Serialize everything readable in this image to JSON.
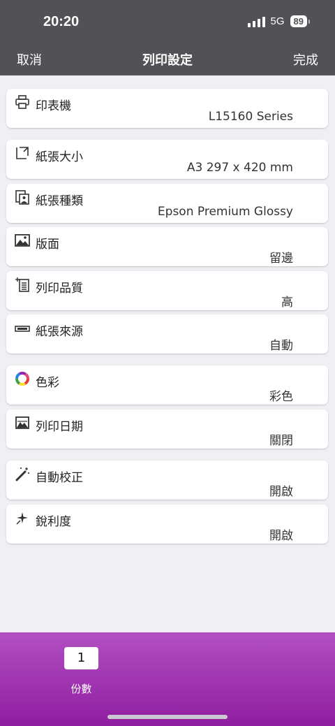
{
  "status_bar": {
    "time": "20:20",
    "network": "5G",
    "battery": "89"
  },
  "nav": {
    "cancel": "取消",
    "title": "列印設定",
    "done": "完成"
  },
  "settings": [
    {
      "label": "印表機",
      "value": "L15160 Series",
      "icon": "printer-icon"
    },
    {
      "label": "紙張大小",
      "value": "A3 297 x 420 mm",
      "icon": "paper-size-icon"
    },
    {
      "label": "紙張種類",
      "value": "Epson Premium Glossy",
      "icon": "paper-type-icon"
    },
    {
      "label": "版面",
      "value": "留邊",
      "icon": "layout-icon"
    },
    {
      "label": "列印品質",
      "value": "高",
      "icon": "print-quality-icon"
    },
    {
      "label": "紙張來源",
      "value": "自動",
      "icon": "paper-source-icon"
    },
    {
      "label": "色彩",
      "value": "彩色",
      "icon": "color-wheel-icon"
    },
    {
      "label": "列印日期",
      "value": "關閉",
      "icon": "print-date-icon"
    },
    {
      "label": "自動校正",
      "value": "開啟",
      "icon": "magic-wand-icon"
    },
    {
      "label": "銳利度",
      "value": "開啟",
      "icon": "sharpness-icon"
    }
  ],
  "copies": {
    "value": "1",
    "label": "份數"
  },
  "colors": {
    "header": "#525256",
    "background": "#efeff4",
    "bottom_gradient_top": "#b24fc2",
    "bottom_gradient_bottom": "#8f1ea0"
  }
}
